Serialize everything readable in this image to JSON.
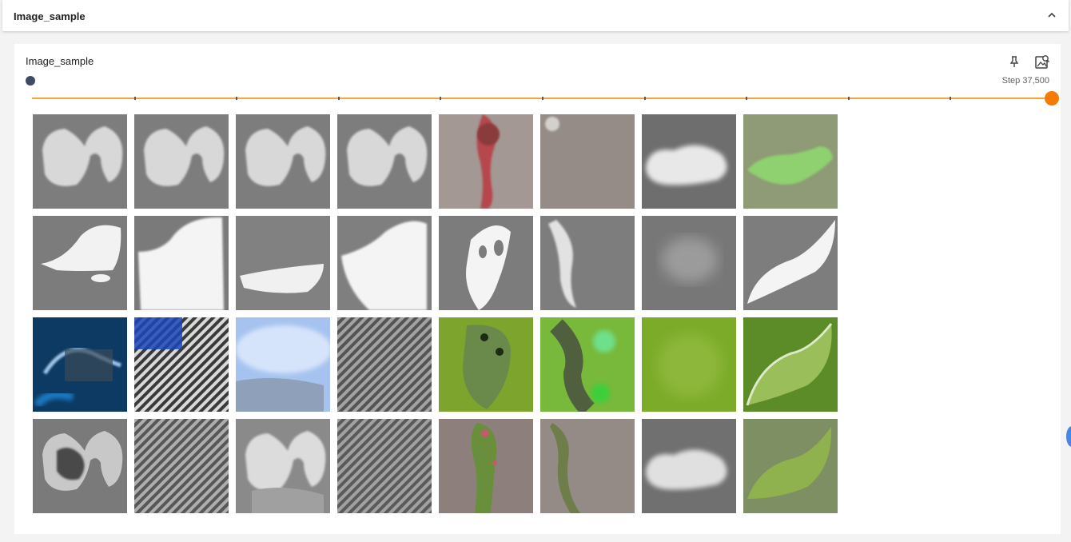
{
  "section": {
    "title": "Image_sample"
  },
  "card": {
    "title": "Image_sample",
    "step_label": "Step 37,500",
    "run_color": "#3f4a63"
  },
  "slider": {
    "position_fraction": 1.0,
    "tick_count": 9,
    "track_color": "#f0a63a",
    "thumb_color": "#f57c00"
  },
  "icons": {
    "collapse": "chevron-up-icon",
    "pin": "pin-icon",
    "fit": "fit-to-screen-icon"
  },
  "images": {
    "rows": [
      [
        "gray-arch",
        "gray-arch",
        "gray-arch",
        "gray-arch",
        "pink-stem",
        "gray-plain",
        "gray-cloud",
        "green-leaf"
      ],
      [
        "white-mask-1",
        "white-mask-2",
        "white-mask-3",
        "white-mask-4",
        "white-mask-5",
        "white-mask-6",
        "gray-blur",
        "white-mask-8"
      ],
      [
        "blue-dark",
        "checker-blue",
        "sky-blue",
        "checker-gray",
        "green-spots",
        "green-wave",
        "green-plain",
        "green-leaf-2"
      ],
      [
        "gray-arch-dark",
        "checker-gray-2",
        "gray-arch-light",
        "checker-gray-3",
        "green-stem",
        "gray-stem",
        "gray-cloud-2",
        "green-leaf-3"
      ]
    ]
  }
}
